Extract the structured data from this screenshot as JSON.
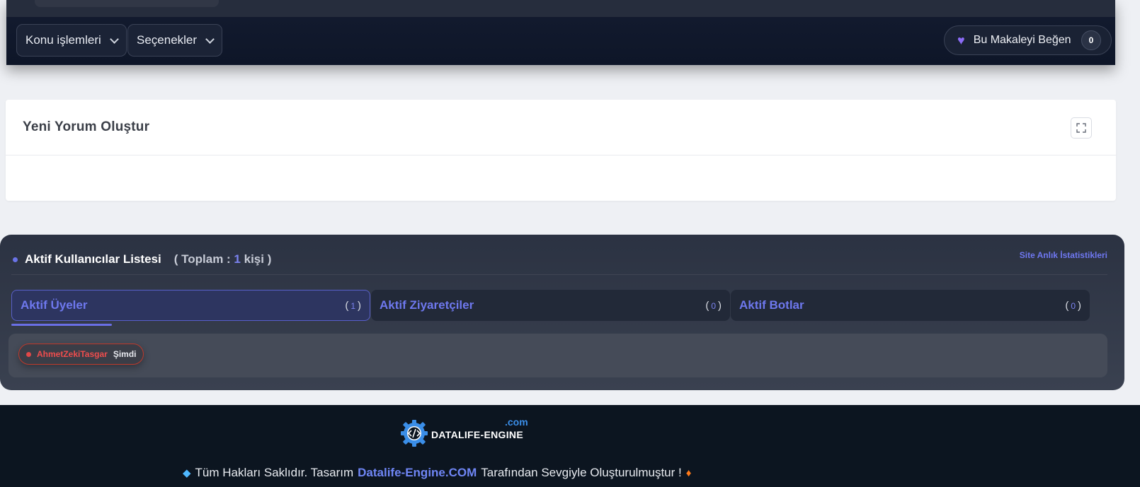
{
  "toolbar": {
    "topic_actions_label": "Konu işlemleri",
    "options_label": "Seçenekler",
    "like_label": "Bu Makaleyi Beğen",
    "like_count": "0"
  },
  "comment": {
    "title": "Yeni Yorum Oluştur"
  },
  "active_users": {
    "title": "Aktif Kullanıcılar Listesi",
    "total_prefix": "( Toplam :",
    "total_count": "1",
    "total_suffix": "kişi )",
    "site_stats_link": "Site Anlık İstatistikleri",
    "tabs": [
      {
        "label": "Aktif Üyeler",
        "count": "1"
      },
      {
        "label": "Aktif Ziyaretçiler",
        "count": "0"
      },
      {
        "label": "Aktif Botlar",
        "count": "0"
      }
    ],
    "users": [
      {
        "name": "AhmetZekiTasgar",
        "time": "Şimdi"
      }
    ]
  },
  "footer": {
    "logo_text": "DATALIFE-ENGINE",
    "logo_suffix": ".com",
    "copyright_prefix": "Tüm Hakları Saklıdır. Tasarım",
    "copyright_brand": "Datalife-Engine.COM",
    "copyright_suffix": "Tarafından Sevgiyle Oluşturulmuştur !"
  },
  "colors": {
    "accent": "#6e78ee",
    "danger": "#ef4d4d",
    "footer_bg": "#0c1520"
  },
  "icons": [
    "chevron-down-icon",
    "heart-icon",
    "expand-icon",
    "gear-code-icon",
    "diamond-icon",
    "fire-icon"
  ]
}
